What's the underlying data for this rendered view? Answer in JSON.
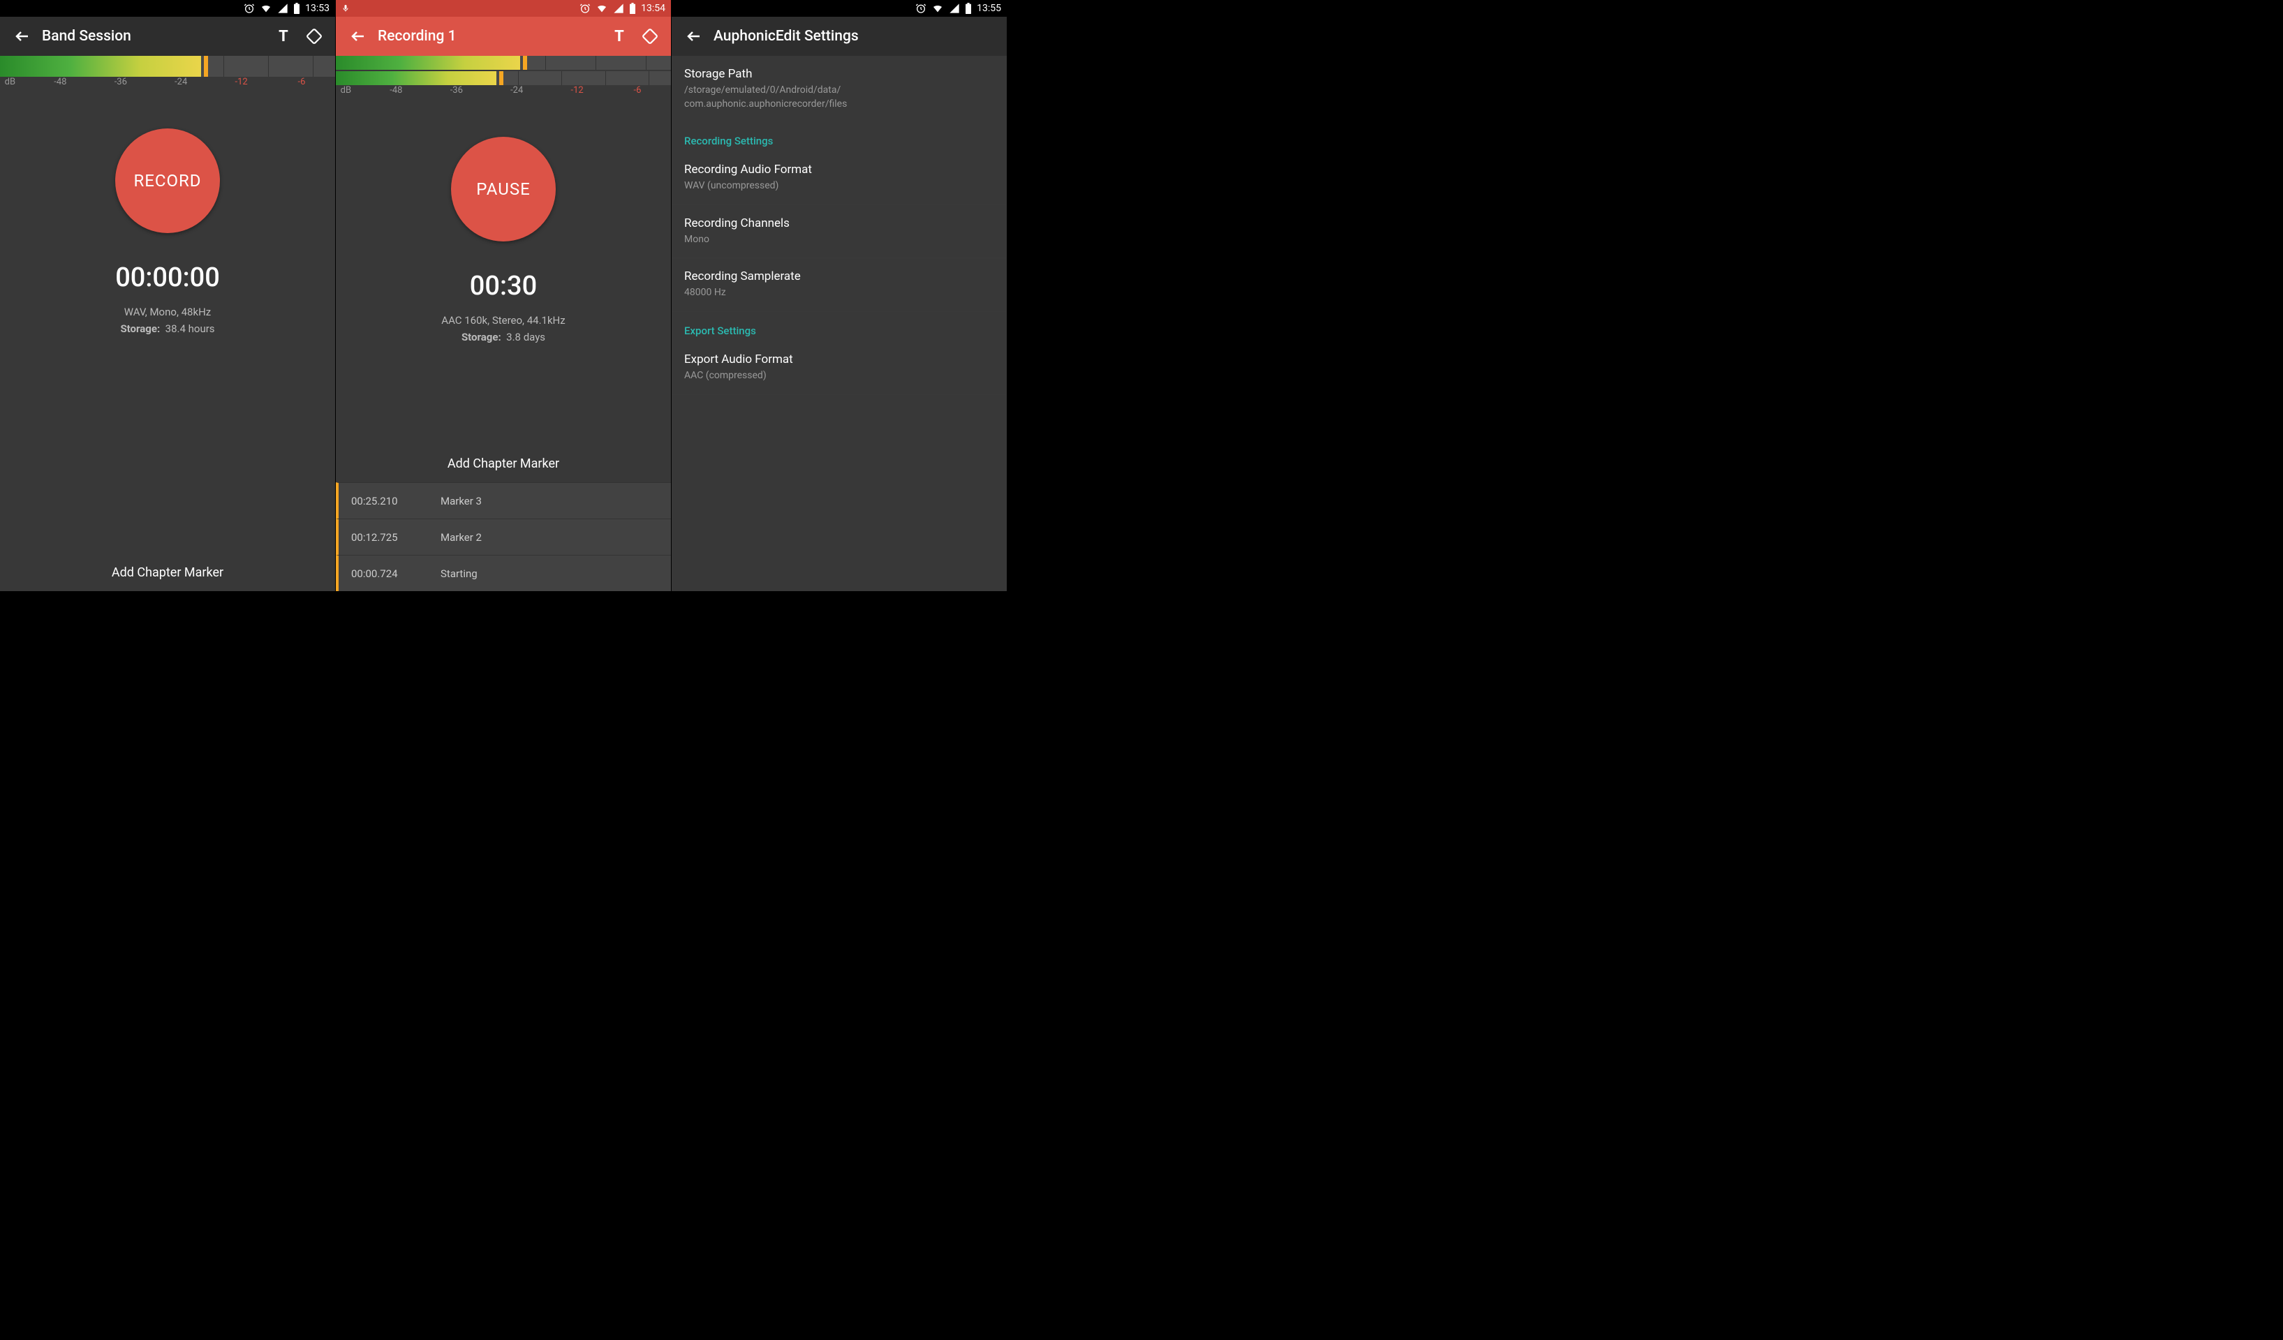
{
  "screen1": {
    "status": {
      "time": "13:53"
    },
    "title": "Band Session",
    "button_label": "RECORD",
    "timer": "00:00:00",
    "format": "WAV, Mono, 48kHz",
    "storage_label": "Storage:",
    "storage_value": "38.4 hours",
    "add_chapter": "Add Chapter Marker",
    "scale": {
      "db": "dB",
      "m48": "-48",
      "m36": "-36",
      "m24": "-24",
      "m12": "-12",
      "m6": "-6"
    }
  },
  "screen2": {
    "status": {
      "time": "13:54"
    },
    "title": "Recording 1",
    "button_label": "PAUSE",
    "timer": "00:30",
    "format": "AAC 160k, Stereo, 44.1kHz",
    "storage_label": "Storage:",
    "storage_value": "3.8 days",
    "add_chapter": "Add Chapter Marker",
    "scale": {
      "db": "dB",
      "m48": "-48",
      "m36": "-36",
      "m24": "-24",
      "m12": "-12",
      "m6": "-6"
    },
    "markers": [
      {
        "time": "00:25.210",
        "label": "Marker 3"
      },
      {
        "time": "00:12.725",
        "label": "Marker 2"
      },
      {
        "time": "00:00.724",
        "label": "Starting"
      }
    ]
  },
  "screen3": {
    "status": {
      "time": "13:55"
    },
    "title": "AuphonicEdit Settings",
    "storage_path_title": "Storage Path",
    "storage_path_value": "/storage/emulated/0/Android/data/\ncom.auphonic.auphonicrecorder/files",
    "section_recording": "Recording Settings",
    "format_title": "Recording Audio Format",
    "format_value": "WAV (uncompressed)",
    "channels_title": "Recording Channels",
    "channels_value": "Mono",
    "samplerate_title": "Recording Samplerate",
    "samplerate_value": "48000 Hz",
    "section_export": "Export Settings",
    "export_format_title": "Export Audio Format",
    "export_format_value": "AAC (compressed)"
  }
}
